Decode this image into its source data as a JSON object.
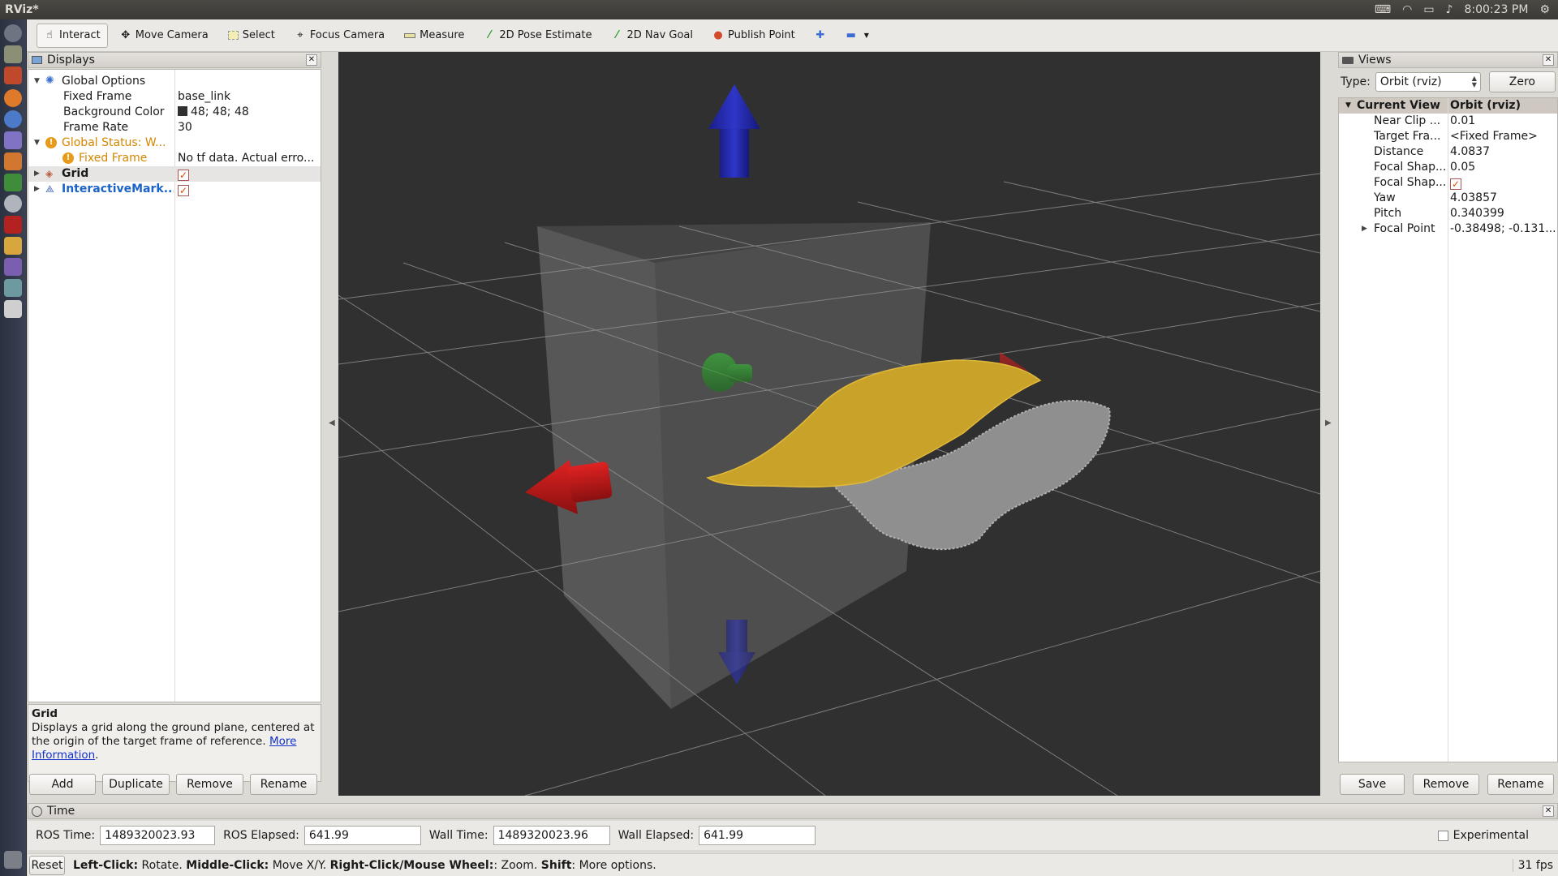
{
  "window": {
    "title": "RViz*"
  },
  "tray": {
    "time": "8:00:23 PM",
    "icons": [
      "keyboard-icon",
      "wifi-icon",
      "battery-icon",
      "volume-icon",
      "gear-icon"
    ]
  },
  "toolbar": {
    "tools": [
      {
        "label": "Interact",
        "icon": "hand-icon"
      },
      {
        "label": "Move Camera",
        "icon": "move-icon"
      },
      {
        "label": "Select",
        "icon": "select-icon"
      },
      {
        "label": "Focus Camera",
        "icon": "focus-icon"
      },
      {
        "label": "Measure",
        "icon": "ruler-icon"
      },
      {
        "label": "2D Pose Estimate",
        "icon": "pose-arrow-icon"
      },
      {
        "label": "2D Nav Goal",
        "icon": "nav-arrow-icon"
      },
      {
        "label": "Publish Point",
        "icon": "pin-icon"
      }
    ]
  },
  "displays": {
    "title": "Displays",
    "global_options": "Global Options",
    "fixed_frame_label": "Fixed Frame",
    "fixed_frame_value": "base_link",
    "bg_color_label": "Background Color",
    "bg_color_value": "48; 48; 48",
    "bg_color_swatch": "#303030",
    "frame_rate_label": "Frame Rate",
    "frame_rate_value": "30",
    "global_status": "Global Status: W...",
    "status_fixed_frame": "Fixed Frame",
    "status_fixed_frame_value": "No tf data.  Actual erro...",
    "grid": "Grid",
    "interactive_markers": "InteractiveMark...",
    "desc_title": "Grid",
    "desc_text": "Displays a grid along the ground plane, centered at the origin of the target frame of reference.",
    "desc_link": "More Information",
    "desc_end": ".",
    "buttons": {
      "add": "Add",
      "duplicate": "Duplicate",
      "remove": "Remove",
      "rename": "Rename"
    }
  },
  "views": {
    "title": "Views",
    "type_label": "Type:",
    "type_value": "Orbit (rviz)",
    "zero": "Zero",
    "current_view": "Current View",
    "current_view_value": "Orbit (rviz)",
    "props": [
      {
        "k": "Near Clip ...",
        "v": "0.01"
      },
      {
        "k": "Target Fra...",
        "v": "<Fixed Frame>"
      },
      {
        "k": "Distance",
        "v": "4.0837"
      },
      {
        "k": "Focal Shap...",
        "v": "0.05"
      },
      {
        "k": "Focal Shap...",
        "v": ""
      },
      {
        "k": "Yaw",
        "v": "4.03857"
      },
      {
        "k": "Pitch",
        "v": "0.340399"
      },
      {
        "k": "Focal Point",
        "v": "-0.38498; -0.131..."
      }
    ],
    "buttons": {
      "save": "Save",
      "remove": "Remove",
      "rename": "Rename"
    }
  },
  "time": {
    "title": "Time",
    "ros_time_label": "ROS Time:",
    "ros_time": "1489320023.93",
    "ros_elapsed_label": "ROS Elapsed:",
    "ros_elapsed": "641.99",
    "wall_time_label": "Wall Time:",
    "wall_time": "1489320023.96",
    "wall_elapsed_label": "Wall Elapsed:",
    "wall_elapsed": "641.99",
    "experimental": "Experimental"
  },
  "status": {
    "reset": "Reset",
    "left_click": "Left-Click:",
    "left_click_text": "Rotate.",
    "middle_click": "Middle-Click:",
    "middle_click_text": "Move X/Y.",
    "right_click": "Right-Click/Mouse Wheel:",
    "right_click_text": ": Zoom.",
    "shift": "Shift",
    "shift_text": ": More options.",
    "fps": "31 fps"
  },
  "colors": {
    "viewport_bg": "#303030",
    "warning": "#d58600",
    "link": "#1b63c6"
  }
}
